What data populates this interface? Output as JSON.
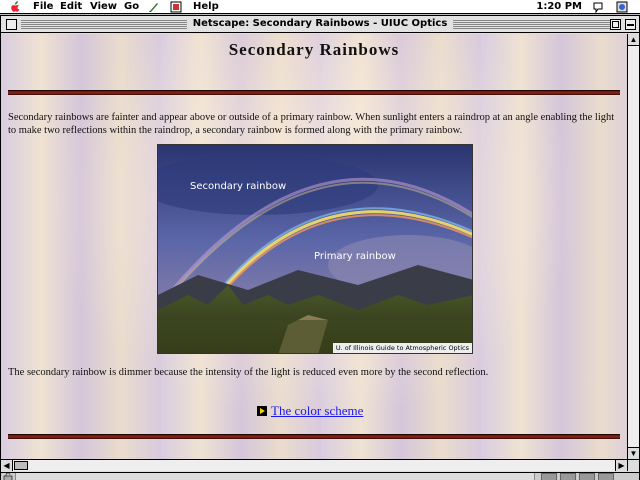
{
  "menubar": {
    "items": [
      "File",
      "Edit",
      "View",
      "Go",
      "Help"
    ],
    "clock": "1:20 PM"
  },
  "window": {
    "title": "Netscape: Secondary Rainbows - UIUC Optics"
  },
  "page": {
    "title": "Secondary Rainbows",
    "intro": "Secondary rainbows are fainter and appear above or outside of a primary rainbow. When sunlight enters a raindrop at an angle enabling the light to make two reflections within the raindrop, a secondary rainbow is formed along with the primary rainbow.",
    "image": {
      "label_secondary": "Secondary rainbow",
      "label_primary": "Primary rainbow",
      "credit": "U. of Illinois Guide to Atmospheric Optics"
    },
    "dimmer_text": "The secondary rainbow is dimmer because the intensity of the light is reduced even more by the second reflection.",
    "link_label": "The color scheme"
  }
}
